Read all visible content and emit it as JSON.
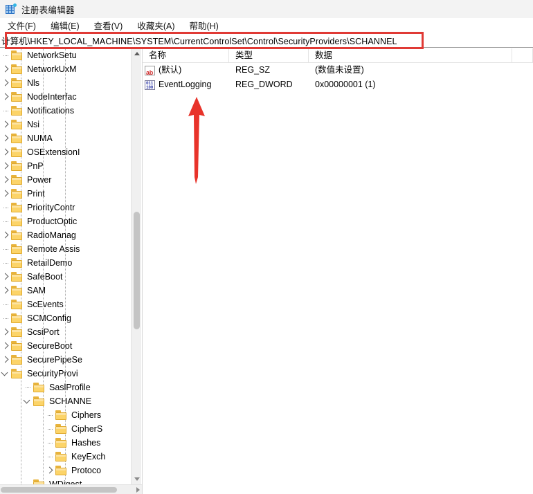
{
  "window": {
    "title": "注册表编辑器",
    "icon": "registry-editor-icon"
  },
  "menubar": {
    "items": [
      {
        "label": "文件(F)"
      },
      {
        "label": "编辑(E)"
      },
      {
        "label": "查看(V)"
      },
      {
        "label": "收藏夹(A)"
      },
      {
        "label": "帮助(H)"
      }
    ]
  },
  "address_bar": {
    "value": "计算机\\HKEY_LOCAL_MACHINE\\SYSTEM\\CurrentControlSet\\Control\\SecurityProviders\\SCHANNEL",
    "highlight_color": "#e03a35"
  },
  "tree": {
    "selected": "SCHANNEL",
    "items": [
      {
        "label": "NetworkSetu",
        "indent": 3,
        "twisty": "leaf",
        "selected": false
      },
      {
        "label": "NetworkUxM",
        "indent": 3,
        "twisty": "collapsed",
        "selected": false
      },
      {
        "label": "Nls",
        "indent": 3,
        "twisty": "collapsed",
        "selected": false
      },
      {
        "label": "NodeInterfac",
        "indent": 3,
        "twisty": "collapsed",
        "selected": false
      },
      {
        "label": "Notifications",
        "indent": 3,
        "twisty": "leaf",
        "selected": false
      },
      {
        "label": "Nsi",
        "indent": 3,
        "twisty": "collapsed",
        "selected": false
      },
      {
        "label": "NUMA",
        "indent": 3,
        "twisty": "collapsed",
        "selected": false
      },
      {
        "label": "OSExtensionI",
        "indent": 3,
        "twisty": "collapsed",
        "selected": false
      },
      {
        "label": "PnP",
        "indent": 3,
        "twisty": "collapsed",
        "selected": false
      },
      {
        "label": "Power",
        "indent": 3,
        "twisty": "collapsed",
        "selected": false
      },
      {
        "label": "Print",
        "indent": 3,
        "twisty": "collapsed",
        "selected": false
      },
      {
        "label": "PriorityContr",
        "indent": 3,
        "twisty": "leaf",
        "selected": false
      },
      {
        "label": "ProductOptic",
        "indent": 3,
        "twisty": "leaf",
        "selected": false
      },
      {
        "label": "RadioManag",
        "indent": 3,
        "twisty": "collapsed",
        "selected": false
      },
      {
        "label": "Remote Assis",
        "indent": 3,
        "twisty": "leaf",
        "selected": false
      },
      {
        "label": "RetailDemo",
        "indent": 3,
        "twisty": "leaf",
        "selected": false
      },
      {
        "label": "SafeBoot",
        "indent": 3,
        "twisty": "collapsed",
        "selected": false
      },
      {
        "label": "SAM",
        "indent": 3,
        "twisty": "collapsed",
        "selected": false
      },
      {
        "label": "ScEvents",
        "indent": 3,
        "twisty": "leaf",
        "selected": false
      },
      {
        "label": "SCMConfig",
        "indent": 3,
        "twisty": "leaf",
        "selected": false
      },
      {
        "label": "ScsiPort",
        "indent": 3,
        "twisty": "collapsed",
        "selected": false
      },
      {
        "label": "SecureBoot",
        "indent": 3,
        "twisty": "collapsed",
        "selected": false
      },
      {
        "label": "SecurePipeSe",
        "indent": 3,
        "twisty": "collapsed",
        "selected": false
      },
      {
        "label": "SecurityProvi",
        "indent": 3,
        "twisty": "expanded",
        "selected": false
      },
      {
        "label": "SaslProfile",
        "indent": 4,
        "twisty": "leaf",
        "selected": false
      },
      {
        "label": "SCHANNE",
        "indent": 4,
        "twisty": "expanded",
        "selected": true
      },
      {
        "label": "Ciphers",
        "indent": 5,
        "twisty": "leaf",
        "selected": false
      },
      {
        "label": "CipherS",
        "indent": 5,
        "twisty": "leaf",
        "selected": false
      },
      {
        "label": "Hashes",
        "indent": 5,
        "twisty": "leaf",
        "selected": false
      },
      {
        "label": "KeyExch",
        "indent": 5,
        "twisty": "leaf",
        "selected": false
      },
      {
        "label": "Protoco",
        "indent": 5,
        "twisty": "collapsed",
        "selected": false
      },
      {
        "label": "WDigest",
        "indent": 4,
        "twisty": "leaf",
        "selected": false
      }
    ]
  },
  "list": {
    "columns": [
      {
        "label": "名称"
      },
      {
        "label": "类型"
      },
      {
        "label": "数据"
      }
    ],
    "rows": [
      {
        "icon": "string-value-icon",
        "icon_kind": "sz",
        "name": "(默认)",
        "type": "REG_SZ",
        "data": "(数值未设置)"
      },
      {
        "icon": "dword-value-icon",
        "icon_kind": "dword",
        "name": "EventLogging",
        "type": "REG_DWORD",
        "data": "0x00000001 (1)"
      }
    ]
  },
  "annotation": {
    "arrow": "red-up-arrow",
    "color": "#e8332a",
    "points_at": "EventLogging"
  }
}
